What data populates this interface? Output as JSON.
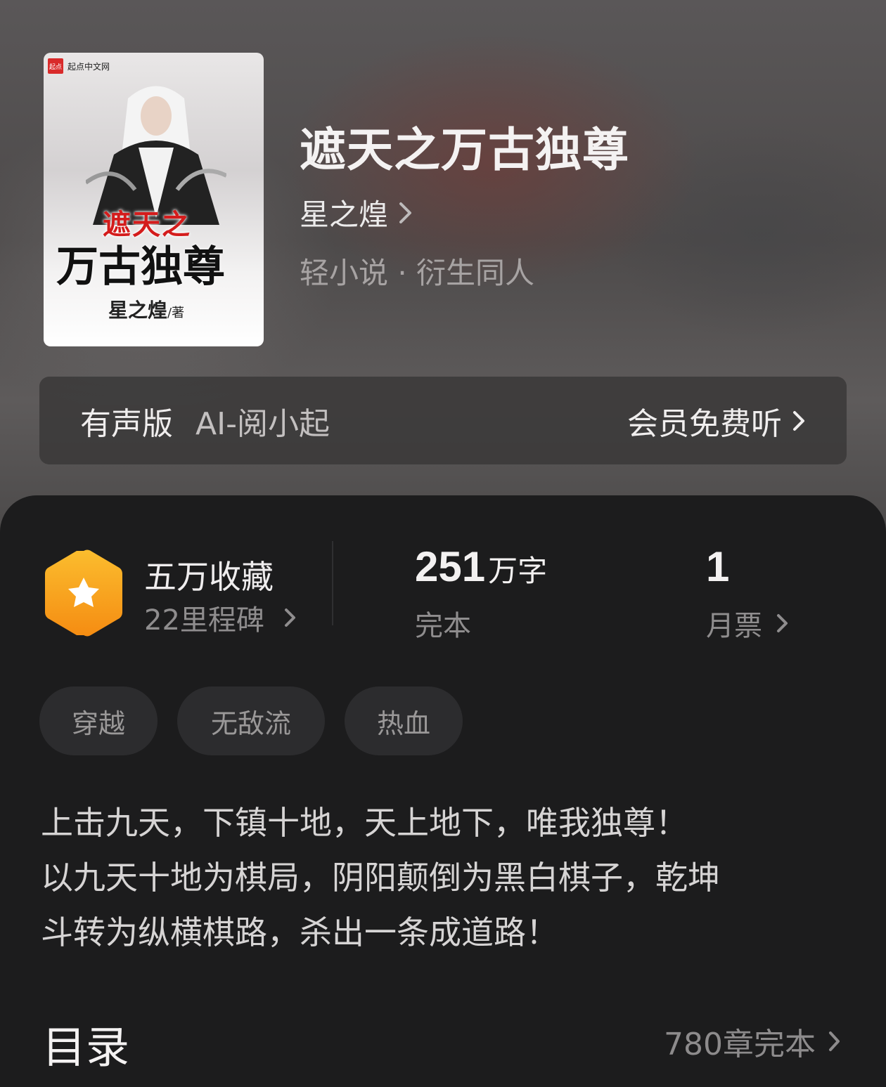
{
  "book": {
    "title": "遮天之万古独尊",
    "author": "星之煌",
    "genre": "轻小说 · 衍生同人"
  },
  "cover": {
    "publisher_badge": "起点",
    "publisher_name": "起点中文网",
    "title_line1": "遮天之",
    "title_line2": "万古独尊",
    "author": "星之煌",
    "author_suffix": "/著"
  },
  "audio": {
    "label": "有声版",
    "narrator": "AI-阅小起",
    "cta": "会员免费听"
  },
  "stats": {
    "favorites_title": "五万收藏",
    "milestones": "22里程碑",
    "word_count": "251",
    "word_unit": "万字",
    "status": "完本",
    "monthly_votes": "1",
    "monthly_votes_label": "月票"
  },
  "tags": [
    "穿越",
    "无敌流",
    "热血"
  ],
  "description": "上击九天，下镇十地，天上地下，唯我独尊！\n以九天十地为棋局，阴阳颠倒为黑白棋子，乾坤\n斗转为纵横棋路，杀出一条成道路！",
  "toc": {
    "title": "目录",
    "meta": "780章完本"
  },
  "colors": {
    "sheet_bg": "#1c1c1d",
    "badge_orange": "#f6a623",
    "tag_bg": "#2c2c2e"
  }
}
